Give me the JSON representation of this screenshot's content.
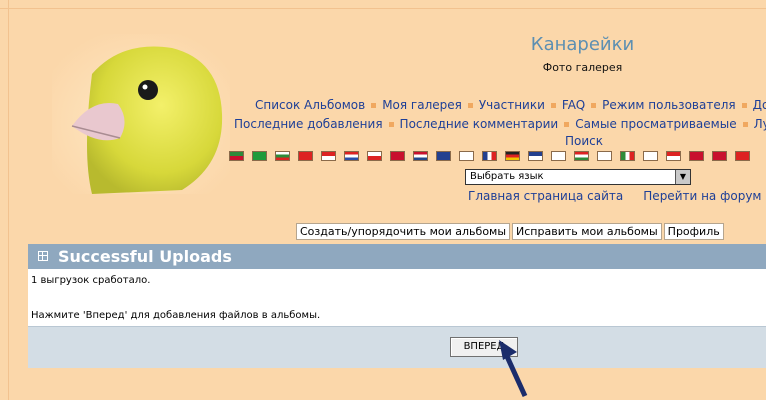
{
  "header": {
    "site_title": "Канарейки",
    "site_subtitle": "Фото галерея"
  },
  "nav_row1": [
    "Список Альбомов",
    "Моя галерея",
    "Участники",
    "FAQ",
    "Режим пользователя",
    "Добави"
  ],
  "nav_row2": [
    "Последние добавления",
    "Последние комментарии",
    "Самые просматриваемые",
    "Лучшие"
  ],
  "search_link": "Поиск",
  "language": {
    "select_value": "Выбрать язык",
    "flags": [
      "flag-icon",
      "flag-icon",
      "flag-icon",
      "flag-icon",
      "flag-icon",
      "flag-icon",
      "flag-icon",
      "flag-icon",
      "flag-icon",
      "flag-icon",
      "flag-icon",
      "flag-icon",
      "flag-icon",
      "flag-icon",
      "flag-icon",
      "flag-icon",
      "flag-icon",
      "flag-icon",
      "flag-icon",
      "flag-icon",
      "flag-icon",
      "flag-icon",
      "flag-icon"
    ]
  },
  "site_links": {
    "home": "Главная страница сайта",
    "forum": "Перейти на форум"
  },
  "tabs": [
    "Создать/упорядочить мои альбомы",
    "Исправить мои альбомы",
    "Профиль"
  ],
  "panel": {
    "title": "Successful Uploads",
    "message_count": "1 выгрузок сработало.",
    "message_hint": "Нажмите 'Вперед' для добавления файлов в альбомы.",
    "button_label": "ВПЕРЕД"
  },
  "colors": {
    "page_bg": "#fbd7aa",
    "link": "#1e3f97",
    "title": "#5c8fb2",
    "panel_header": "#8fa8bf",
    "panel_footer": "#d3dde5"
  }
}
